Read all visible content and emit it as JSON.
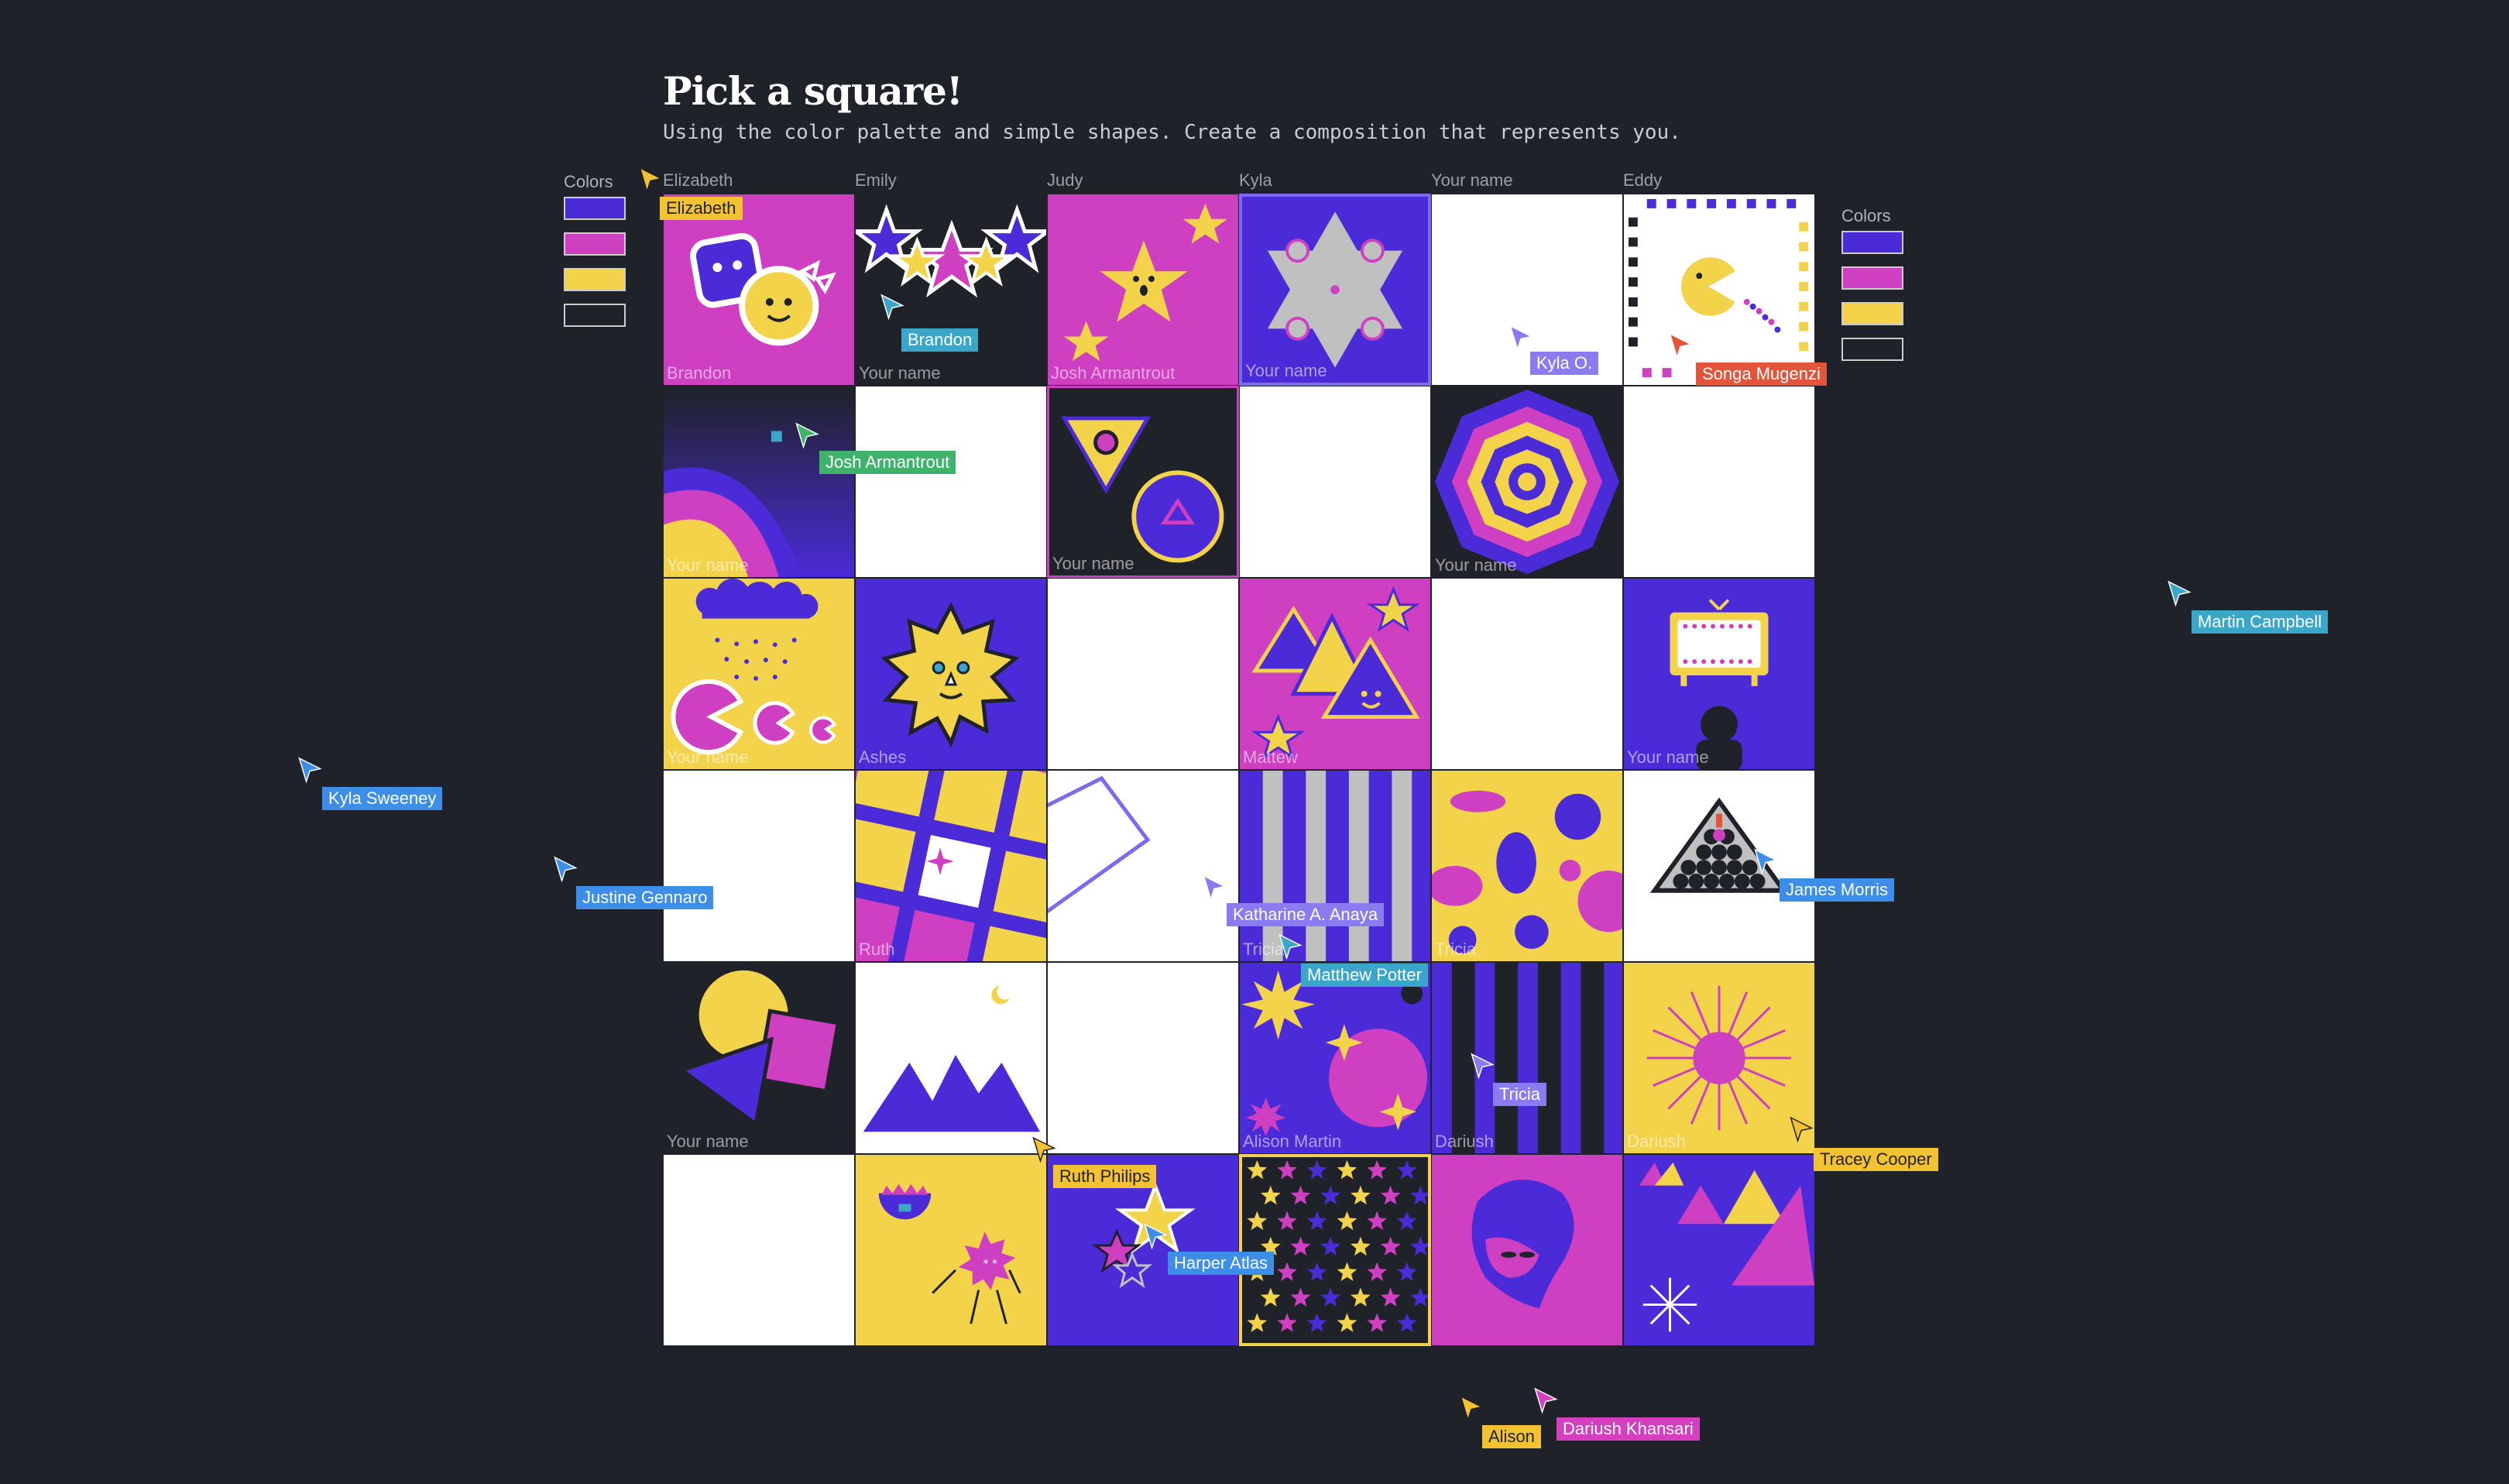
{
  "header": {
    "title": "Pick a square!",
    "subtitle": "Using the color palette and simple shapes. Create a composition that represents you."
  },
  "palette_left": {
    "label": "Colors",
    "colors": [
      "#4b2bd8",
      "#cf3fc2",
      "#f3d34a",
      "#20222a"
    ]
  },
  "palette_right": {
    "label": "Colors",
    "colors": [
      "#4b2bd8",
      "#cf3fc2",
      "#f3d34a",
      "#20222a"
    ]
  },
  "columns": [
    "Elizabeth",
    "Emily",
    "Judy",
    "Kyla",
    "Your name",
    "Eddy"
  ],
  "cells": [
    "Brandon",
    "Your name",
    "Josh Armantrout",
    "Your name",
    "",
    "",
    "Your name",
    "",
    "Your name",
    "",
    "Your name",
    "",
    "Your name",
    "Ashes",
    "",
    "Mattew",
    "",
    "Your name",
    "",
    "Ruth",
    "",
    "Tricia",
    "Tricia",
    "",
    "Your name",
    "",
    "",
    "Alison Martin",
    "Dariush",
    "Dariush",
    "",
    "",
    "",
    "",
    "",
    ""
  ],
  "cursors": [
    {
      "name": "Elizabeth",
      "color": "#f3c233",
      "text": "#1f2228"
    },
    {
      "name": "Brandon",
      "color": "#3aa7c9",
      "text": "#ffffff"
    },
    {
      "name": "Kyla O.",
      "color": "#8a7cf0",
      "text": "#ffffff"
    },
    {
      "name": "Songa Mugenzi",
      "color": "#e2553b",
      "text": "#ffffff"
    },
    {
      "name": "Josh Armantrout",
      "color": "#3fb26c",
      "text": "#ffffff"
    },
    {
      "name": "Martin Campbell",
      "color": "#3aa7c9",
      "text": "#ffffff"
    },
    {
      "name": "Kyla Sweeney",
      "color": "#3c8ee8",
      "text": "#ffffff"
    },
    {
      "name": "Justine Gennaro",
      "color": "#3c8ee8",
      "text": "#ffffff"
    },
    {
      "name": "Katharine A. Anaya",
      "color": "#8a7cf0",
      "text": "#ffffff"
    },
    {
      "name": "James Morris",
      "color": "#3c8ee8",
      "text": "#ffffff"
    },
    {
      "name": "Matthew Potter",
      "color": "#3aa7c9",
      "text": "#ffffff"
    },
    {
      "name": "Tricia",
      "color": "#8a7cf0",
      "text": "#ffffff"
    },
    {
      "name": "Tracey Cooper",
      "color": "#f3c233",
      "text": "#1f2228"
    },
    {
      "name": "Ruth Philips",
      "color": "#f3c233",
      "text": "#1f2228"
    },
    {
      "name": "Harper Atlas",
      "color": "#3c8ee8",
      "text": "#ffffff"
    },
    {
      "name": "Alison",
      "color": "#f3c233",
      "text": "#1f2228"
    },
    {
      "name": "Dariush Khansari",
      "color": "#d43fc0",
      "text": "#ffffff"
    }
  ]
}
